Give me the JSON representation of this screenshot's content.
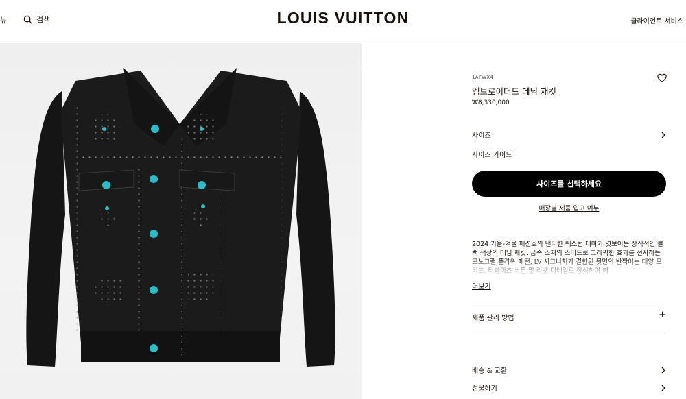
{
  "header": {
    "menu_fragment": "뉴",
    "search_label": "검색",
    "logo": "LOUIS VUITTON",
    "client_service": "클라이언트 서비스"
  },
  "product": {
    "sku": "1AFWX4",
    "title": "엠브로이더드 데님 재킷",
    "price": "₩8,330,000"
  },
  "options": {
    "size_label": "사이즈",
    "size_guide": "사이즈 가이드",
    "cta": "사이즈를 선택하세요",
    "store_availability": "매장별 제품 입고 여부"
  },
  "description": {
    "text": "2024 가을-겨울 패션쇼의 댄디한 웨스턴 테마가 엿보이는 장식적인 블랙 색상의 데님 재킷. 금속 소재의 스터드로 그래픽한 효과를 선사하는 모노그램 플라워 패턴, LV 시그니처가 결합된 뒷면의 반짝이는 태양 모티프, 터콰이즈 버튼 및 리벳 디테일로 장식하여 해",
    "more": "더보기"
  },
  "accordion": {
    "care_label": "제품 관리 방법",
    "shipping_label": "배송 & 교환",
    "gift_label": "선물하기"
  },
  "colors": {
    "cta_bg": "#000000",
    "turquoise": "#2bbcc6"
  },
  "icons": {
    "search": "search-icon",
    "wishlist": "heart-icon",
    "chevron": "chevron-right-icon",
    "plus": "plus-icon"
  }
}
